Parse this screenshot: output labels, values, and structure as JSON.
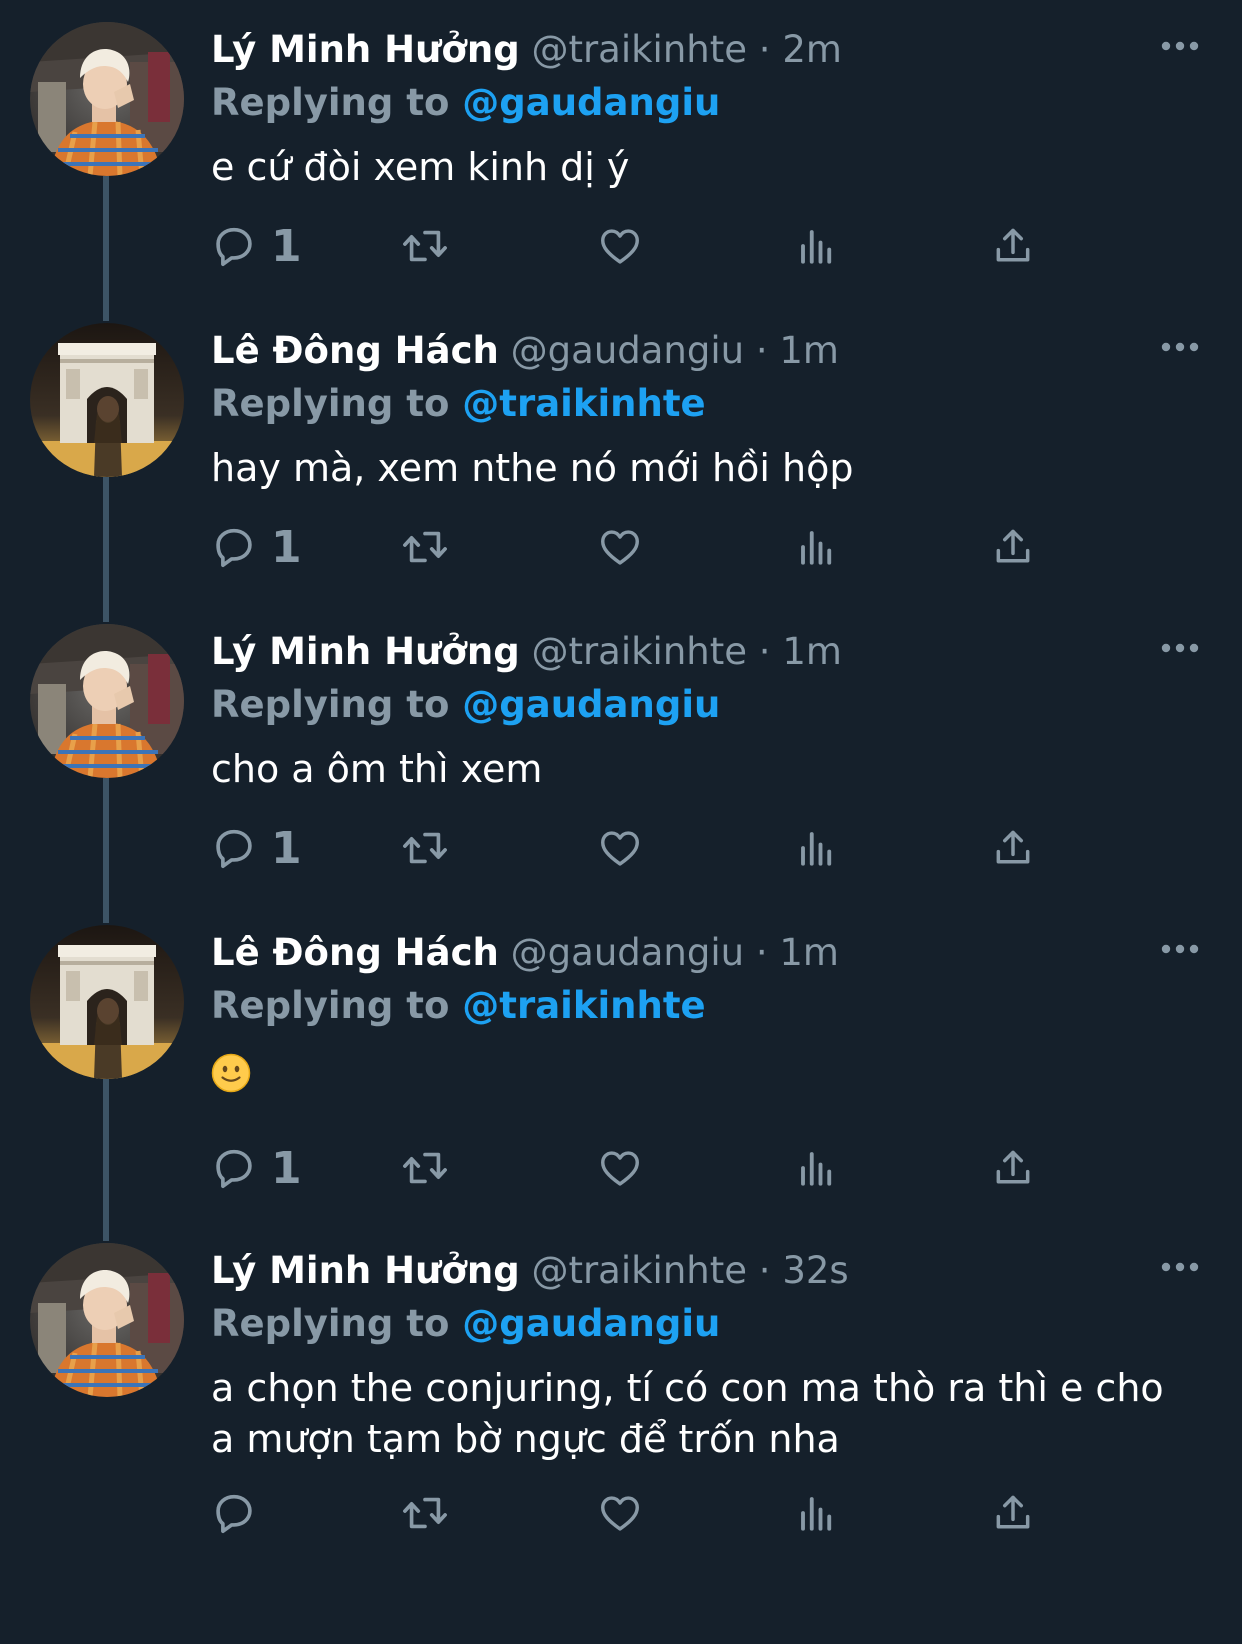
{
  "thread": {
    "tweets": [
      {
        "name": "Lý Minh Hưởng",
        "handle": "@traikinhte",
        "separator": "·",
        "time": "2m",
        "replying_prefix": "Replying to",
        "replying_to": "@gaudangiu",
        "text": "e cứ đòi xem kinh dị ý",
        "reply_count": "1",
        "avatar_icon": "avatar-photo-young-man-orange-plaid"
      },
      {
        "name": "Lê Đông Hách",
        "handle": "@gaudangiu",
        "separator": "·",
        "time": "1m",
        "replying_prefix": "Replying to",
        "replying_to": "@traikinhte",
        "text": "hay mà, xem nthe nó mới hồi hộp",
        "reply_count": "1",
        "avatar_icon": "avatar-photo-arc-de-triomphe-night"
      },
      {
        "name": "Lý Minh Hưởng",
        "handle": "@traikinhte",
        "separator": "·",
        "time": "1m",
        "replying_prefix": "Replying to",
        "replying_to": "@gaudangiu",
        "text": "cho a ôm thì xem",
        "reply_count": "1",
        "avatar_icon": "avatar-photo-young-man-orange-plaid"
      },
      {
        "name": "Lê Đông Hách",
        "handle": "@gaudangiu",
        "separator": "·",
        "time": "1m",
        "replying_prefix": "Replying to",
        "replying_to": "@traikinhte",
        "text": "🙂",
        "reply_count": "1",
        "avatar_icon": "avatar-photo-arc-de-triomphe-night"
      },
      {
        "name": "Lý Minh Hưởng",
        "handle": "@traikinhte",
        "separator": "·",
        "time": "32s",
        "replying_prefix": "Replying to",
        "replying_to": "@gaudangiu",
        "text": "a chọn the conjuring, tí có con ma thò ra thì e cho a mượn tạm bờ ngực để trốn nha",
        "reply_count": "",
        "avatar_icon": "avatar-photo-young-man-orange-plaid"
      }
    ]
  },
  "icons": {
    "reply": "reply-icon",
    "retweet": "retweet-icon",
    "like": "heart-icon",
    "analytics": "analytics-icon",
    "share": "share-icon",
    "more": "more-icon"
  },
  "colors": {
    "background": "#15202b",
    "secondary_text": "#8899a6",
    "accent": "#1da1f2",
    "thread_line": "#3d5466"
  }
}
